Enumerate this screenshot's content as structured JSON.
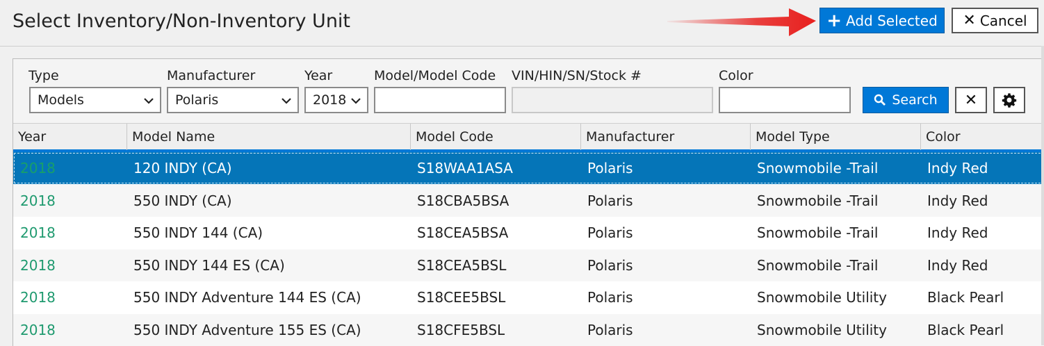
{
  "dialog": {
    "title": "Select Inventory/Non-Inventory Unit",
    "add_selected_label": "Add Selected",
    "cancel_label": "Cancel",
    "arrow_color": "#e8201e"
  },
  "filters": {
    "type": {
      "label": "Type",
      "value": "Models"
    },
    "manufacturer": {
      "label": "Manufacturer",
      "value": "Polaris"
    },
    "year": {
      "label": "Year",
      "value": "2018"
    },
    "model_code": {
      "label": "Model/Model Code",
      "value": ""
    },
    "vin": {
      "label": "VIN/HIN/SN/Stock #",
      "value": ""
    },
    "color": {
      "label": "Color",
      "value": ""
    },
    "search_label": "Search"
  },
  "table": {
    "columns": [
      "Year",
      "Model Name",
      "Model Code",
      "Manufacturer",
      "Model Type",
      "Color"
    ],
    "rows": [
      [
        "2018",
        "120 INDY (CA)",
        "S18WAA1ASA",
        "Polaris",
        "Snowmobile -Trail",
        "Indy Red"
      ],
      [
        "2018",
        "550 INDY (CA)",
        "S18CBA5BSA",
        "Polaris",
        "Snowmobile -Trail",
        "Indy Red"
      ],
      [
        "2018",
        "550 INDY 144 (CA)",
        "S18CEA5BSA",
        "Polaris",
        "Snowmobile -Trail",
        "Indy Red"
      ],
      [
        "2018",
        "550 INDY 144 ES (CA)",
        "S18CEA5BSL",
        "Polaris",
        "Snowmobile -Trail",
        "Indy Red"
      ],
      [
        "2018",
        "550 INDY Adventure 144 ES (CA)",
        "S18CEE5BSL",
        "Polaris",
        "Snowmobile Utility",
        "Black Pearl"
      ],
      [
        "2018",
        "550 INDY Adventure 155 ES (CA)",
        "S18CFE5BSL",
        "Polaris",
        "Snowmobile Utility",
        "Black Pearl"
      ]
    ],
    "selected_row": 0
  },
  "colors": {
    "accent": "#0078d7",
    "selected_row": "#0575b8",
    "year_text": "#1f9a6f"
  }
}
